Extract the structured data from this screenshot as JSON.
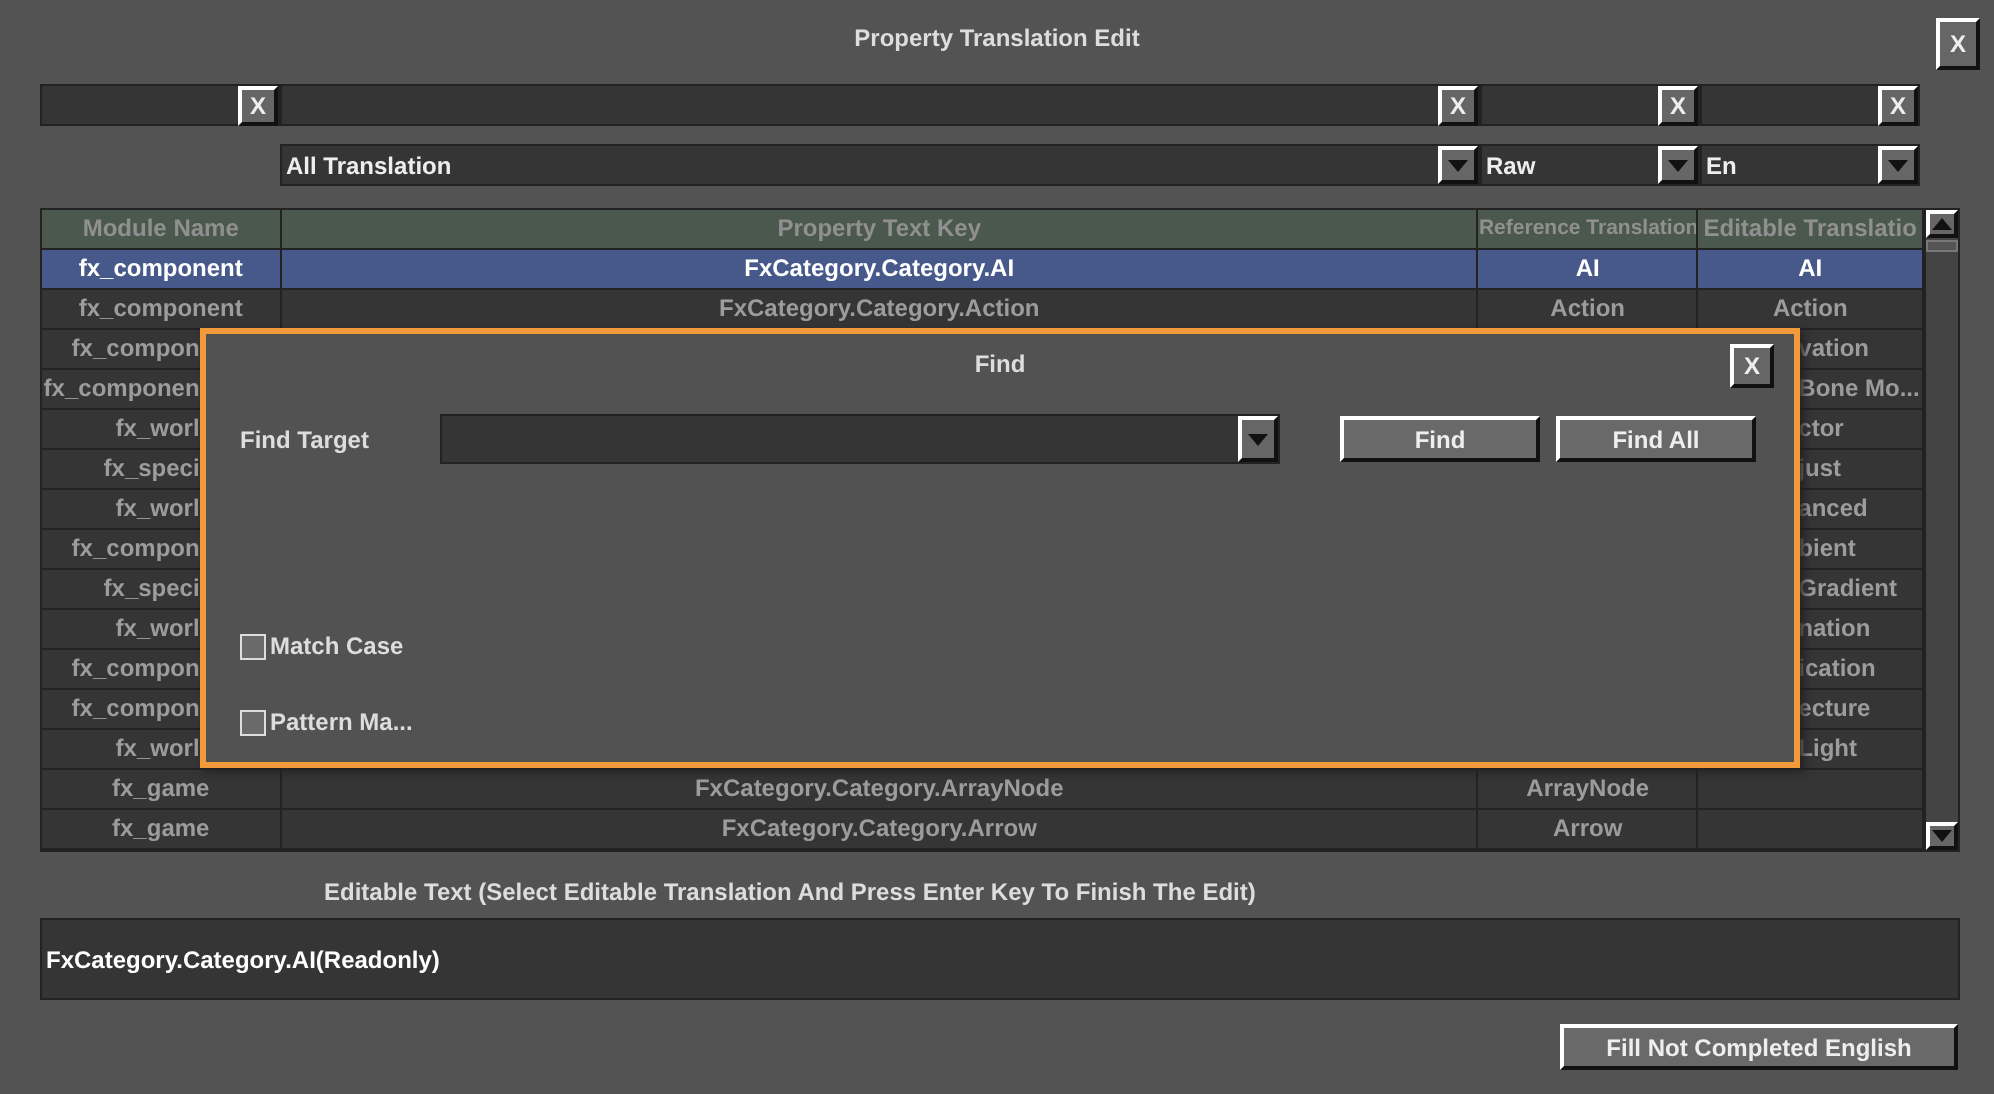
{
  "window": {
    "title": "Property Translation Edit",
    "close": "X"
  },
  "filters": [
    {
      "clear": "X"
    },
    {
      "clear": "X"
    },
    {
      "clear": "X"
    },
    {
      "clear": "X"
    }
  ],
  "dropdowns": [
    {
      "value": "All Translation"
    },
    {
      "value": "Raw"
    },
    {
      "value": "En"
    }
  ],
  "table": {
    "columns": [
      "Module Name",
      "Property Text Key",
      "Reference Translation",
      "Editable Translatio"
    ],
    "rows": [
      {
        "kind": "full",
        "selected": true,
        "cells": [
          "fx_component",
          "FxCategory.Category.AI",
          "AI",
          "AI"
        ]
      },
      {
        "kind": "full",
        "selected": false,
        "cells": [
          "fx_component",
          "FxCategory.Category.Action",
          "Action",
          "Action"
        ]
      },
      {
        "kind": "covered",
        "selected": false,
        "cells": [
          "fx_compon",
          "vation"
        ]
      },
      {
        "kind": "covered",
        "selected": false,
        "cells": [
          "fx_componen",
          "Bone Mo..."
        ]
      },
      {
        "kind": "covered",
        "selected": false,
        "cells": [
          "fx_worl",
          "ctor"
        ]
      },
      {
        "kind": "covered",
        "selected": false,
        "cells": [
          "fx_speci",
          "just"
        ]
      },
      {
        "kind": "covered",
        "selected": false,
        "cells": [
          "fx_worl",
          "anced"
        ]
      },
      {
        "kind": "covered",
        "selected": false,
        "cells": [
          "fx_compon",
          "bient"
        ]
      },
      {
        "kind": "covered",
        "selected": false,
        "cells": [
          "fx_speci",
          "Gradient"
        ]
      },
      {
        "kind": "covered",
        "selected": false,
        "cells": [
          "fx_worl",
          "nation"
        ]
      },
      {
        "kind": "covered",
        "selected": false,
        "cells": [
          "fx_compon",
          "ication"
        ]
      },
      {
        "kind": "covered",
        "selected": false,
        "cells": [
          "fx_compon",
          "ecture"
        ]
      },
      {
        "kind": "covered",
        "selected": false,
        "cells": [
          "fx_worl",
          "Light"
        ]
      },
      {
        "kind": "full",
        "selected": false,
        "cells": [
          "fx_game",
          "FxCategory.Category.ArrayNode",
          "ArrayNode"
        ]
      },
      {
        "kind": "full",
        "selected": false,
        "cells": [
          "fx_game",
          "FxCategory.Category.Arrow",
          "Arrow"
        ]
      }
    ]
  },
  "editor": {
    "label": "Editable Text (Select Editable Translation And Press Enter Key To Finish The Edit)",
    "value": "FxCategory.Category.AI(Readonly)"
  },
  "fill_button": "Fill Not Completed English",
  "find_dialog": {
    "title": "Find",
    "close": "X",
    "target_label": "Find Target",
    "buttons": [
      "Find",
      "Find All"
    ],
    "options": [
      {
        "label": "Match Case",
        "checked": false
      },
      {
        "label": "Pattern Ma...",
        "checked": false
      }
    ]
  }
}
